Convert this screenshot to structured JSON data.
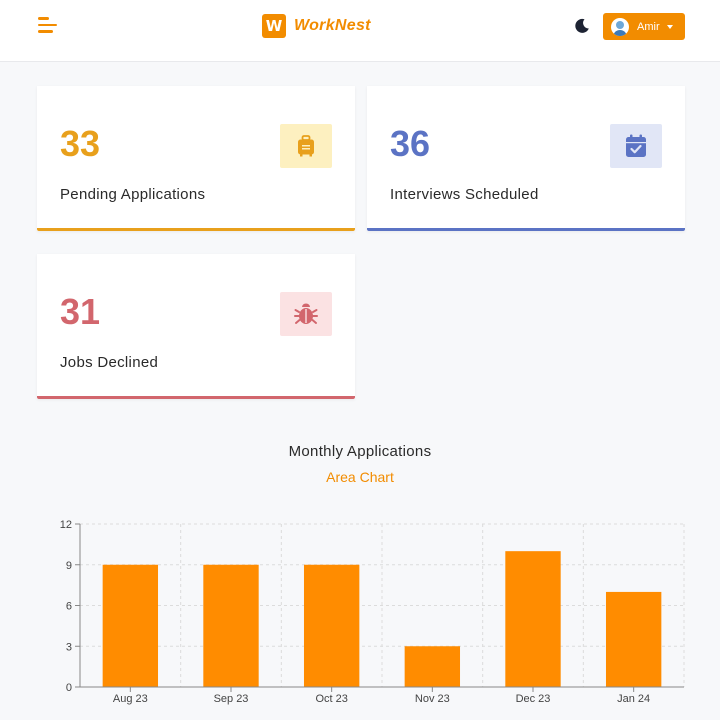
{
  "header": {
    "brand_logo_letter": "W",
    "brand_name": "WorkNest",
    "user_name": "Amir"
  },
  "cards": [
    {
      "value": "33",
      "label": "Pending Applications",
      "color": "#e8a01c",
      "icon_bg": "#fdf0c0",
      "icon": "suitcase-icon"
    },
    {
      "value": "36",
      "label": "Interviews Scheduled",
      "color": "#5b73c4",
      "icon_bg": "#e1e6f6",
      "icon": "calendar-check-icon"
    },
    {
      "value": "31",
      "label": "Jobs Declined",
      "color": "#d2666d",
      "icon_bg": "#fbe2e3",
      "icon": "bug-icon"
    }
  ],
  "chart": {
    "title": "Monthly Applications",
    "subtitle": "Area Chart"
  },
  "chart_data": {
    "type": "bar",
    "categories": [
      "Aug 23",
      "Sep 23",
      "Oct 23",
      "Nov 23",
      "Dec 23",
      "Jan 24"
    ],
    "values": [
      9,
      9,
      9,
      3,
      10,
      7
    ],
    "ylim": [
      0,
      12
    ],
    "yticks": [
      0,
      3,
      6,
      9,
      12
    ],
    "grid": true,
    "bar_color": "#ff8c00"
  }
}
